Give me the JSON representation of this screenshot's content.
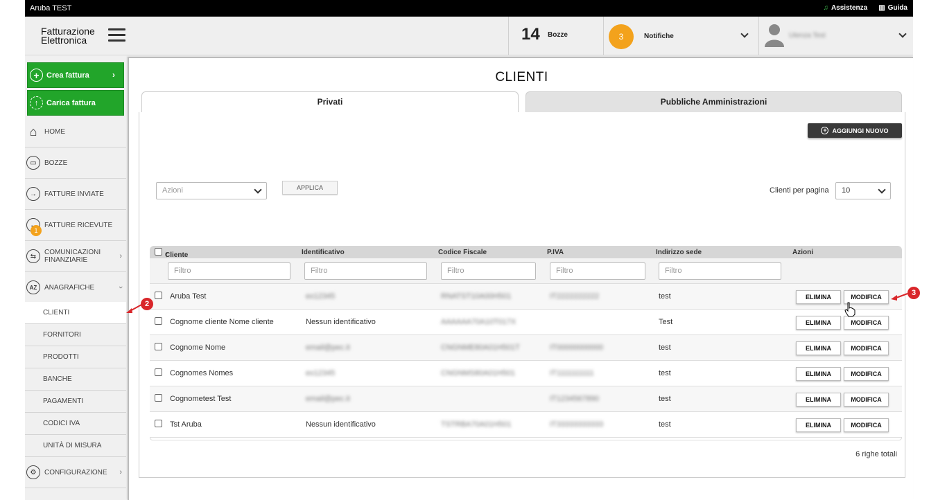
{
  "topbar": {
    "brand": "Aruba TEST",
    "assistenza": "Assistenza",
    "guida": "Guida"
  },
  "header": {
    "logo_line1": "Fatturazione",
    "logo_line2": "Elettronica",
    "bozze_count": "14",
    "bozze_label": "Bozze",
    "notif_count": "3",
    "notif_label": "Notifiche",
    "user_name": "Utenza Test"
  },
  "sidebar": {
    "crea": "Crea fattura",
    "carica": "Carica fattura",
    "items": [
      "HOME",
      "BOZZE",
      "FATTURE INVIATE",
      "FATTURE RICEVUTE",
      "COMUNICAZIONI FINANZIARIE",
      "ANAGRAFICHE"
    ],
    "ricevute_badge": "1",
    "sub": [
      "CLIENTI",
      "FORNITORI",
      "PRODOTTI",
      "BANCHE",
      "PAGAMENTI",
      "CODICI IVA",
      "UNITÀ DI MISURA"
    ],
    "configurazione": "CONFIGURAZIONE"
  },
  "main": {
    "title": "CLIENTI",
    "tabs": [
      "Privati",
      "Pubbliche Amministrazioni"
    ],
    "add_button": "AGGIUNGI NUOVO",
    "azioni_placeholder": "Azioni",
    "applica": "APPLICA",
    "perpage_label": "Clienti per pagina",
    "perpage_value": "10",
    "columns": [
      "Cliente",
      "Identificativo",
      "Codice Fiscale",
      "P.IVA",
      "Indirizzo sede",
      "Azioni"
    ],
    "sort_indicator": "↑",
    "filter_placeholder": "Filtro",
    "rows": [
      {
        "cliente": "Aruba Test",
        "identificativo": "ex12345",
        "cf": "RNATST10A00H501",
        "piva": "IT2222222222",
        "indirizzo": "test"
      },
      {
        "cliente": "Cognome cliente Nome cliente",
        "identificativo": "Nessun identificativo",
        "cf": "AAAAAA70A10T017X",
        "piva": "",
        "indirizzo": "Test"
      },
      {
        "cliente": "Cognome Nome",
        "identificativo": "email@pec.it",
        "cf": "CNGNME80A01H501T",
        "piva": "IT00000000000",
        "indirizzo": "test"
      },
      {
        "cliente": "Cognomes Nomes",
        "identificativo": "ex12345",
        "cf": "CNGNMS80A01H501",
        "piva": "IT1111111111",
        "indirizzo": "test"
      },
      {
        "cliente": "Cognometest Test",
        "identificativo": "email@pec.it",
        "cf": "",
        "piva": "IT1234567890",
        "indirizzo": "test"
      },
      {
        "cliente": "Tst Aruba",
        "identificativo": "Nessun identificativo",
        "cf": "TSTRBA70A01H501",
        "piva": "IT33333333333",
        "indirizzo": "test"
      }
    ],
    "elimina": "ELIMINA",
    "modifica": "MODIFICA",
    "total": "6 righe totali"
  },
  "annotations": [
    "2",
    "3"
  ],
  "colors": {
    "green": "#22a52a",
    "orange": "#f3a21c",
    "dark_button": "#3a3a3a",
    "annotation_red": "#d9262a"
  }
}
